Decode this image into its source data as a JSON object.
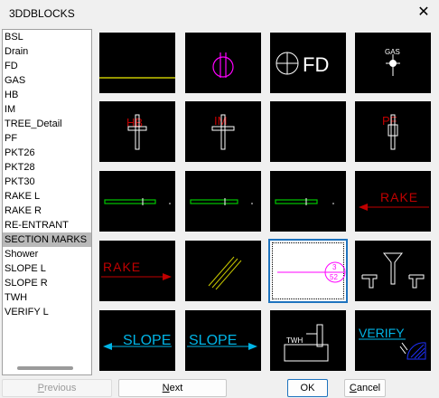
{
  "window": {
    "title": "3DDBLOCKS",
    "close_glyph": "✕"
  },
  "list": {
    "items": [
      "BSL",
      "Drain",
      "FD",
      "GAS",
      "HB",
      "IM",
      "TREE_Detail",
      "PF",
      "PKT26",
      "PKT28",
      "PKT30",
      "RAKE L",
      "RAKE R",
      "RE-ENTRANT",
      "SECTION MARKS",
      "Shower",
      "SLOPE L",
      "SLOPE R",
      "TWH",
      "VERIFY L"
    ],
    "selected_index": 14
  },
  "thumbnails": {
    "fd_text": "FD",
    "gas_text": "GAS",
    "hb_text": "HB",
    "im_text": "IM",
    "pf_text": "PF",
    "rake_text": "RAKE",
    "section_top": "3",
    "section_bottom": "52",
    "slope_text": "SLOPE",
    "twh_text": "TWH",
    "verify_text": "VERIFY"
  },
  "buttons": {
    "previous_first": "P",
    "previous_rest": "revious",
    "next_first": "N",
    "next_rest": "ext",
    "ok": "OK",
    "cancel_first": "C",
    "cancel_rest": "ancel"
  },
  "colors": {
    "accent": "#1e73be",
    "selection": "#b9b9b9",
    "tile_bg": "#000000",
    "yellow": "#c8c800",
    "magenta": "#ff00ff",
    "white": "#ffffff",
    "red": "#c00000",
    "green": "#00c800",
    "cyan": "#00b4e6",
    "blue": "#1e32ff"
  }
}
